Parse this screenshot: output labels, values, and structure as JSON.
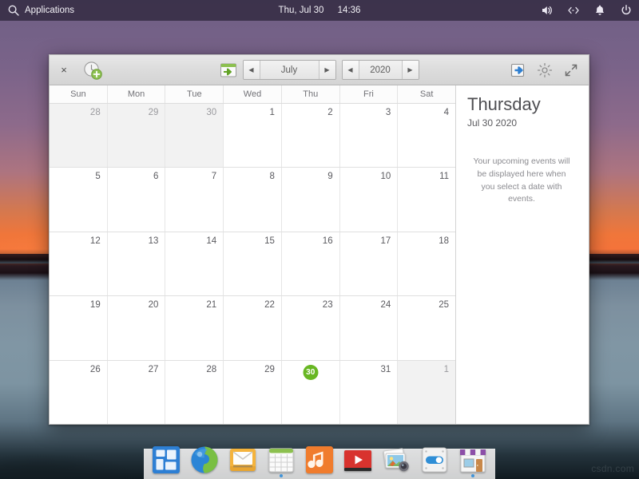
{
  "topbar": {
    "search_icon": "search-icon",
    "applications_label": "Applications",
    "clock_date": "Thu, Jul 30",
    "clock_time": "14:36",
    "indicators": [
      {
        "name": "volume-icon",
        "label": "Sound"
      },
      {
        "name": "network-icon",
        "label": "Network"
      },
      {
        "name": "notifications-bell-icon",
        "label": "Notifications"
      },
      {
        "name": "power-icon",
        "label": "Session"
      }
    ]
  },
  "calendar_window": {
    "titlebar": {
      "close_label": "×",
      "new_event_icon": "new-event-clock-plus-icon",
      "today_icon": "go-to-today-calendar-icon",
      "month": "July",
      "year": "2020",
      "prev_arrow": "◀",
      "next_arrow": "▶",
      "import_icon": "import-export-icon",
      "settings_icon": "gear-icon",
      "fullscreen_icon": "fullscreen-arrows-icon"
    },
    "day_headers": [
      "Sun",
      "Mon",
      "Tue",
      "Wed",
      "Thu",
      "Fri",
      "Sat"
    ],
    "weeks": [
      [
        {
          "n": "28",
          "other": true
        },
        {
          "n": "29",
          "other": true
        },
        {
          "n": "30",
          "other": true
        },
        {
          "n": "1"
        },
        {
          "n": "2"
        },
        {
          "n": "3"
        },
        {
          "n": "4"
        }
      ],
      [
        {
          "n": "5"
        },
        {
          "n": "6"
        },
        {
          "n": "7"
        },
        {
          "n": "8"
        },
        {
          "n": "9"
        },
        {
          "n": "10"
        },
        {
          "n": "11"
        }
      ],
      [
        {
          "n": "12"
        },
        {
          "n": "13"
        },
        {
          "n": "14"
        },
        {
          "n": "15"
        },
        {
          "n": "16"
        },
        {
          "n": "17"
        },
        {
          "n": "18"
        }
      ],
      [
        {
          "n": "19"
        },
        {
          "n": "20"
        },
        {
          "n": "21"
        },
        {
          "n": "22"
        },
        {
          "n": "23"
        },
        {
          "n": "24"
        },
        {
          "n": "25"
        }
      ],
      [
        {
          "n": "26"
        },
        {
          "n": "27"
        },
        {
          "n": "28"
        },
        {
          "n": "29"
        },
        {
          "n": "30",
          "today": true
        },
        {
          "n": "31"
        },
        {
          "n": "1",
          "other": true
        }
      ]
    ],
    "sidebar": {
      "day_name": "Thursday",
      "date_full": "Jul 30 2020",
      "empty_message": "Your upcoming events will be displayed here when you select a date with events."
    },
    "accent_color": "#68b723"
  },
  "dock": {
    "items": [
      {
        "name": "dock-item-applications",
        "label": "Applications",
        "running": false
      },
      {
        "name": "dock-item-web-browser",
        "label": "Web Browser",
        "running": false
      },
      {
        "name": "dock-item-mail",
        "label": "Mail",
        "running": false
      },
      {
        "name": "dock-item-calendar",
        "label": "Calendar",
        "running": true
      },
      {
        "name": "dock-item-music",
        "label": "Music",
        "running": false
      },
      {
        "name": "dock-item-videos",
        "label": "Videos",
        "running": false
      },
      {
        "name": "dock-item-photos",
        "label": "Photos",
        "running": false
      },
      {
        "name": "dock-item-system-settings",
        "label": "System Settings",
        "running": false
      },
      {
        "name": "dock-item-appcenter",
        "label": "AppCenter",
        "running": true
      }
    ]
  },
  "watermark": "csdn.com"
}
